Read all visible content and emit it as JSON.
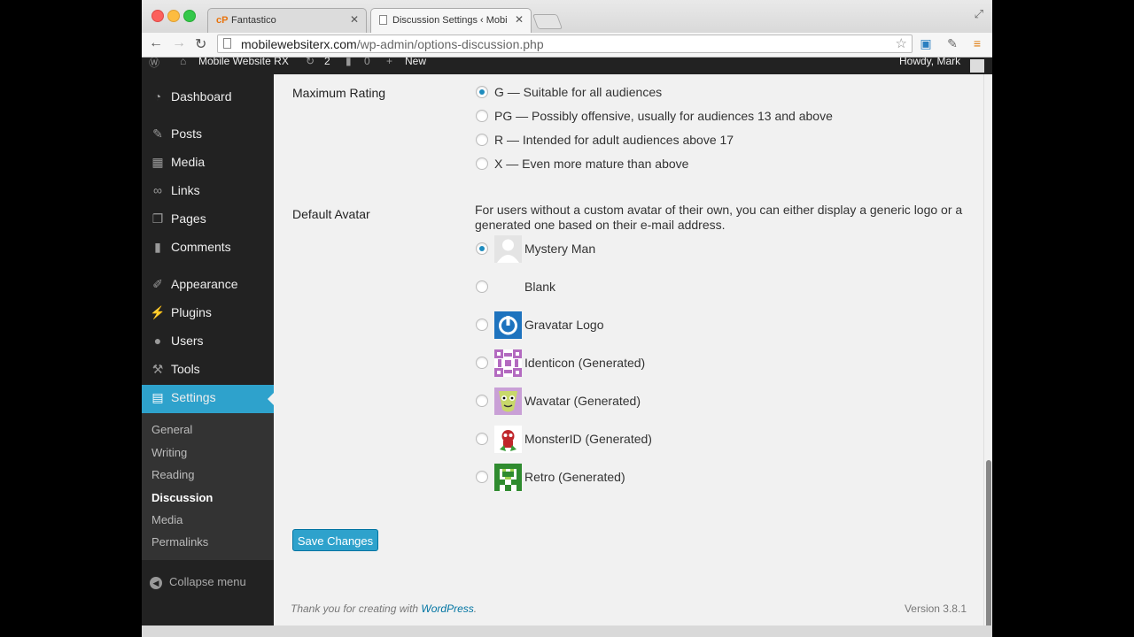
{
  "browser": {
    "tabs": [
      {
        "title": "Fantastico",
        "favicon": "cP"
      },
      {
        "title": "Discussion Settings ‹ Mobi"
      }
    ],
    "url_host": "mobilewebsiterx.com",
    "url_path": "/wp-admin/options-discussion.php"
  },
  "adminbar": {
    "site": "Mobile Website RX",
    "updates": "2",
    "comments": "0",
    "new_label": "New",
    "howdy": "Howdy, Mark"
  },
  "sidebar": {
    "items": [
      {
        "label": "Dashboard",
        "icon": "dashboard-icon"
      },
      {
        "label": "Posts",
        "icon": "pin-icon"
      },
      {
        "label": "Media",
        "icon": "media-icon"
      },
      {
        "label": "Links",
        "icon": "link-icon"
      },
      {
        "label": "Pages",
        "icon": "pages-icon"
      },
      {
        "label": "Comments",
        "icon": "comment-icon"
      },
      {
        "label": "Appearance",
        "icon": "brush-icon"
      },
      {
        "label": "Plugins",
        "icon": "plug-icon"
      },
      {
        "label": "Users",
        "icon": "user-icon"
      },
      {
        "label": "Tools",
        "icon": "wrench-icon"
      },
      {
        "label": "Settings",
        "icon": "settings-icon"
      }
    ],
    "submenu": [
      "General",
      "Writing",
      "Reading",
      "Discussion",
      "Media",
      "Permalinks"
    ],
    "collapse": "Collapse menu"
  },
  "content": {
    "max_rating": {
      "label": "Maximum Rating",
      "options": [
        "G — Suitable for all audiences",
        "PG — Possibly offensive, usually for audiences 13 and above",
        "R — Intended for adult audiences above 17",
        "X — Even more mature than above"
      ],
      "selected": 0
    },
    "default_avatar": {
      "label": "Default Avatar",
      "description": "For users without a custom avatar of their own, you can either display a generic logo or a generated one based on their e-mail address.",
      "options": [
        "Mystery Man",
        "Blank",
        "Gravatar Logo",
        "Identicon (Generated)",
        "Wavatar (Generated)",
        "MonsterID (Generated)",
        "Retro (Generated)"
      ],
      "selected": 0
    },
    "save_label": "Save Changes",
    "footer_text": "Thank you for creating with ",
    "footer_link": "WordPress",
    "footer_end": ".",
    "version": "Version 3.8.1"
  },
  "colors": {
    "accent": "#2ea2cc",
    "sidebar_bg": "#222222",
    "link": "#0074a2"
  }
}
